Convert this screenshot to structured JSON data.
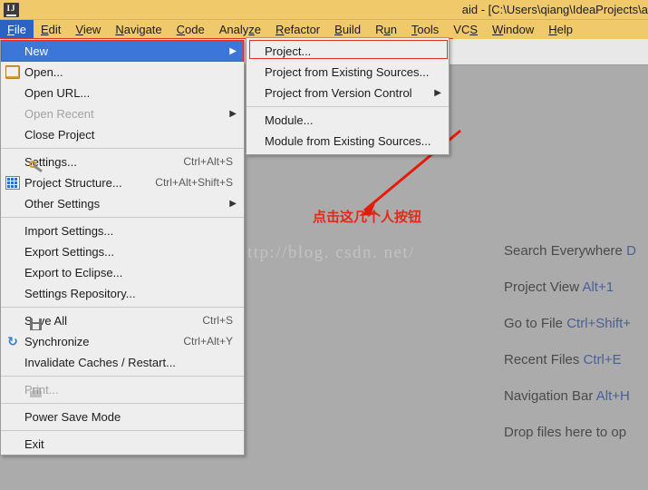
{
  "window": {
    "logo_text": "IJ",
    "title": "aid - [C:\\Users\\qiang\\IdeaProjects\\a"
  },
  "menubar": {
    "items": [
      {
        "label": "File",
        "mnemonic": "F",
        "selected": true
      },
      {
        "label": "Edit",
        "mnemonic": "E",
        "selected": false
      },
      {
        "label": "View",
        "mnemonic": "V",
        "selected": false
      },
      {
        "label": "Navigate",
        "mnemonic": "N",
        "selected": false
      },
      {
        "label": "Code",
        "mnemonic": "C",
        "selected": false
      },
      {
        "label": "Analyze",
        "mnemonic": "z",
        "selected": false
      },
      {
        "label": "Refactor",
        "mnemonic": "R",
        "selected": false
      },
      {
        "label": "Build",
        "mnemonic": "B",
        "selected": false
      },
      {
        "label": "Run",
        "mnemonic": "u",
        "selected": false
      },
      {
        "label": "Tools",
        "mnemonic": "T",
        "selected": false
      },
      {
        "label": "VCS",
        "mnemonic": "S",
        "selected": false
      },
      {
        "label": "Window",
        "mnemonic": "W",
        "selected": false
      },
      {
        "label": "Help",
        "mnemonic": "H",
        "selected": false
      }
    ]
  },
  "file_menu": {
    "rows": [
      {
        "label": "New",
        "icon": "",
        "accel": "",
        "arrow": true,
        "highlight": true,
        "disabled": false
      },
      {
        "label": "Open...",
        "icon": "folder",
        "accel": "",
        "arrow": false,
        "highlight": false,
        "disabled": false
      },
      {
        "label": "Open URL...",
        "icon": "",
        "accel": "",
        "arrow": false,
        "highlight": false,
        "disabled": false
      },
      {
        "label": "Open Recent",
        "icon": "",
        "accel": "",
        "arrow": true,
        "highlight": false,
        "disabled": true
      },
      {
        "label": "Close Project",
        "icon": "",
        "accel": "",
        "arrow": false,
        "highlight": false,
        "disabled": false
      },
      {
        "separator": true
      },
      {
        "label": "Settings...",
        "icon": "wrench",
        "accel": "Ctrl+Alt+S",
        "arrow": false,
        "highlight": false,
        "disabled": false
      },
      {
        "label": "Project Structure...",
        "icon": "grid",
        "accel": "Ctrl+Alt+Shift+S",
        "arrow": false,
        "highlight": false,
        "disabled": false
      },
      {
        "label": "Other Settings",
        "icon": "",
        "accel": "",
        "arrow": true,
        "highlight": false,
        "disabled": false
      },
      {
        "separator": true
      },
      {
        "label": "Import Settings...",
        "icon": "",
        "accel": "",
        "arrow": false,
        "highlight": false,
        "disabled": false
      },
      {
        "label": "Export Settings...",
        "icon": "",
        "accel": "",
        "arrow": false,
        "highlight": false,
        "disabled": false
      },
      {
        "label": "Export to Eclipse...",
        "icon": "",
        "accel": "",
        "arrow": false,
        "highlight": false,
        "disabled": false
      },
      {
        "label": "Settings Repository...",
        "icon": "",
        "accel": "",
        "arrow": false,
        "highlight": false,
        "disabled": false
      },
      {
        "separator": true
      },
      {
        "label": "Save All",
        "icon": "save",
        "accel": "Ctrl+S",
        "arrow": false,
        "highlight": false,
        "disabled": false
      },
      {
        "label": "Synchronize",
        "icon": "sync",
        "accel": "Ctrl+Alt+Y",
        "arrow": false,
        "highlight": false,
        "disabled": false
      },
      {
        "label": "Invalidate Caches / Restart...",
        "icon": "",
        "accel": "",
        "arrow": false,
        "highlight": false,
        "disabled": false
      },
      {
        "separator": true
      },
      {
        "label": "Print...",
        "icon": "print",
        "accel": "",
        "arrow": false,
        "highlight": false,
        "disabled": true
      },
      {
        "separator": true
      },
      {
        "label": "Power Save Mode",
        "icon": "",
        "accel": "",
        "arrow": false,
        "highlight": false,
        "disabled": false
      },
      {
        "separator": true
      },
      {
        "label": "Exit",
        "icon": "",
        "accel": "",
        "arrow": false,
        "highlight": false,
        "disabled": false
      }
    ]
  },
  "new_submenu": {
    "rows": [
      {
        "label": "Project...",
        "arrow": false
      },
      {
        "label": "Project from Existing Sources...",
        "arrow": false
      },
      {
        "label": "Project from Version Control",
        "arrow": true
      },
      {
        "separator": true
      },
      {
        "label": "Module...",
        "arrow": false
      },
      {
        "label": "Module from Existing Sources...",
        "arrow": false
      }
    ]
  },
  "welcome_hints": [
    {
      "text": "Search Everywhere ",
      "key": "D"
    },
    {
      "text": "Project View ",
      "key": "Alt+1"
    },
    {
      "text": "Go to File ",
      "key": "Ctrl+Shift+"
    },
    {
      "text": "Recent Files ",
      "key": "Ctrl+E"
    },
    {
      "text": "Navigation Bar ",
      "key": "Alt+H"
    },
    {
      "text": "Drop files here to op",
      "key": ""
    }
  ],
  "watermark": {
    "text": "http://blog. csdn. net/"
  },
  "annotations": {
    "note_cn": "点击这几个人按钮",
    "accent_color": "#e03025"
  }
}
